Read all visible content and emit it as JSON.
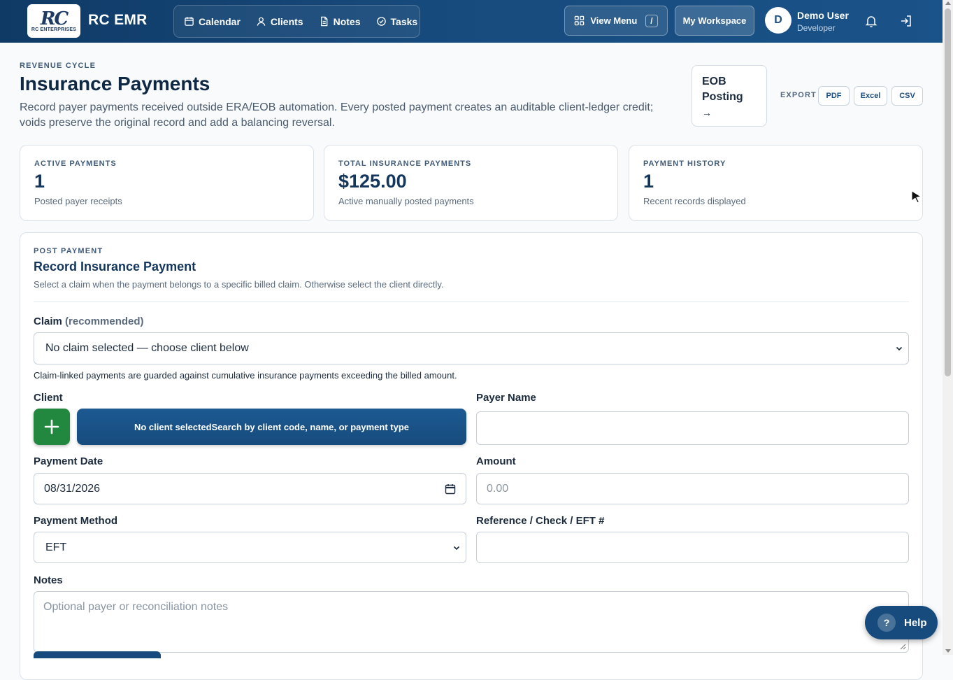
{
  "app": {
    "logo_mark": "RC",
    "logo_sub": "RC ENTERPRISES",
    "brand": "RC EMR"
  },
  "nav": [
    {
      "label": "Calendar",
      "icon": "calendar-icon"
    },
    {
      "label": "Clients",
      "icon": "user-icon"
    },
    {
      "label": "Notes",
      "icon": "document-icon"
    },
    {
      "label": "Tasks",
      "icon": "check-circle-icon"
    }
  ],
  "topbar": {
    "view_menu": "View Menu",
    "view_menu_shortcut": "/",
    "workspace": "My Workspace",
    "user_initial": "D",
    "user_name": "Demo User",
    "user_role": "Developer"
  },
  "header": {
    "eyebrow": "REVENUE CYCLE",
    "title": "Insurance Payments",
    "description": "Record payer payments received outside ERA/EOB automation. Every posted payment creates an auditable client-ledger credit; voids preserve the original record and add a balancing reversal.",
    "eob_line1": "EOB",
    "eob_line2": "Posting",
    "eob_arrow": "→",
    "export_label": "EXPORT",
    "export_buttons": [
      "PDF",
      "Excel",
      "CSV"
    ]
  },
  "stats": [
    {
      "label": "ACTIVE PAYMENTS",
      "value": "1",
      "caption": "Posted payer receipts"
    },
    {
      "label": "TOTAL INSURANCE PAYMENTS",
      "value": "$125.00",
      "caption": "Active manually posted payments"
    },
    {
      "label": "PAYMENT HISTORY",
      "value": "1",
      "caption": "Recent records displayed"
    }
  ],
  "form": {
    "eyebrow": "POST PAYMENT",
    "title": "Record Insurance Payment",
    "description": "Select a claim when the payment belongs to a specific billed claim. Otherwise select the client directly.",
    "claim_label": "Claim",
    "claim_label_note": "(recommended)",
    "claim_value": "No claim selected — choose client below",
    "claim_hint": "Claim-linked payments are guarded against cumulative insurance payments exceeding the billed amount.",
    "client_label": "Client",
    "client_picker": "No client selectedSearch by client code, name, or payment type",
    "payer_label": "Payer Name",
    "payer_value": "",
    "date_label": "Payment Date",
    "date_value": "08/31/2026",
    "amount_label": "Amount",
    "amount_placeholder": "0.00",
    "method_label": "Payment Method",
    "method_value": "EFT",
    "reference_label": "Reference / Check / EFT #",
    "reference_value": "",
    "notes_label": "Notes",
    "notes_placeholder": "Optional payer or reconciliation notes"
  },
  "help": {
    "label": "Help",
    "icon_glyph": "?"
  }
}
